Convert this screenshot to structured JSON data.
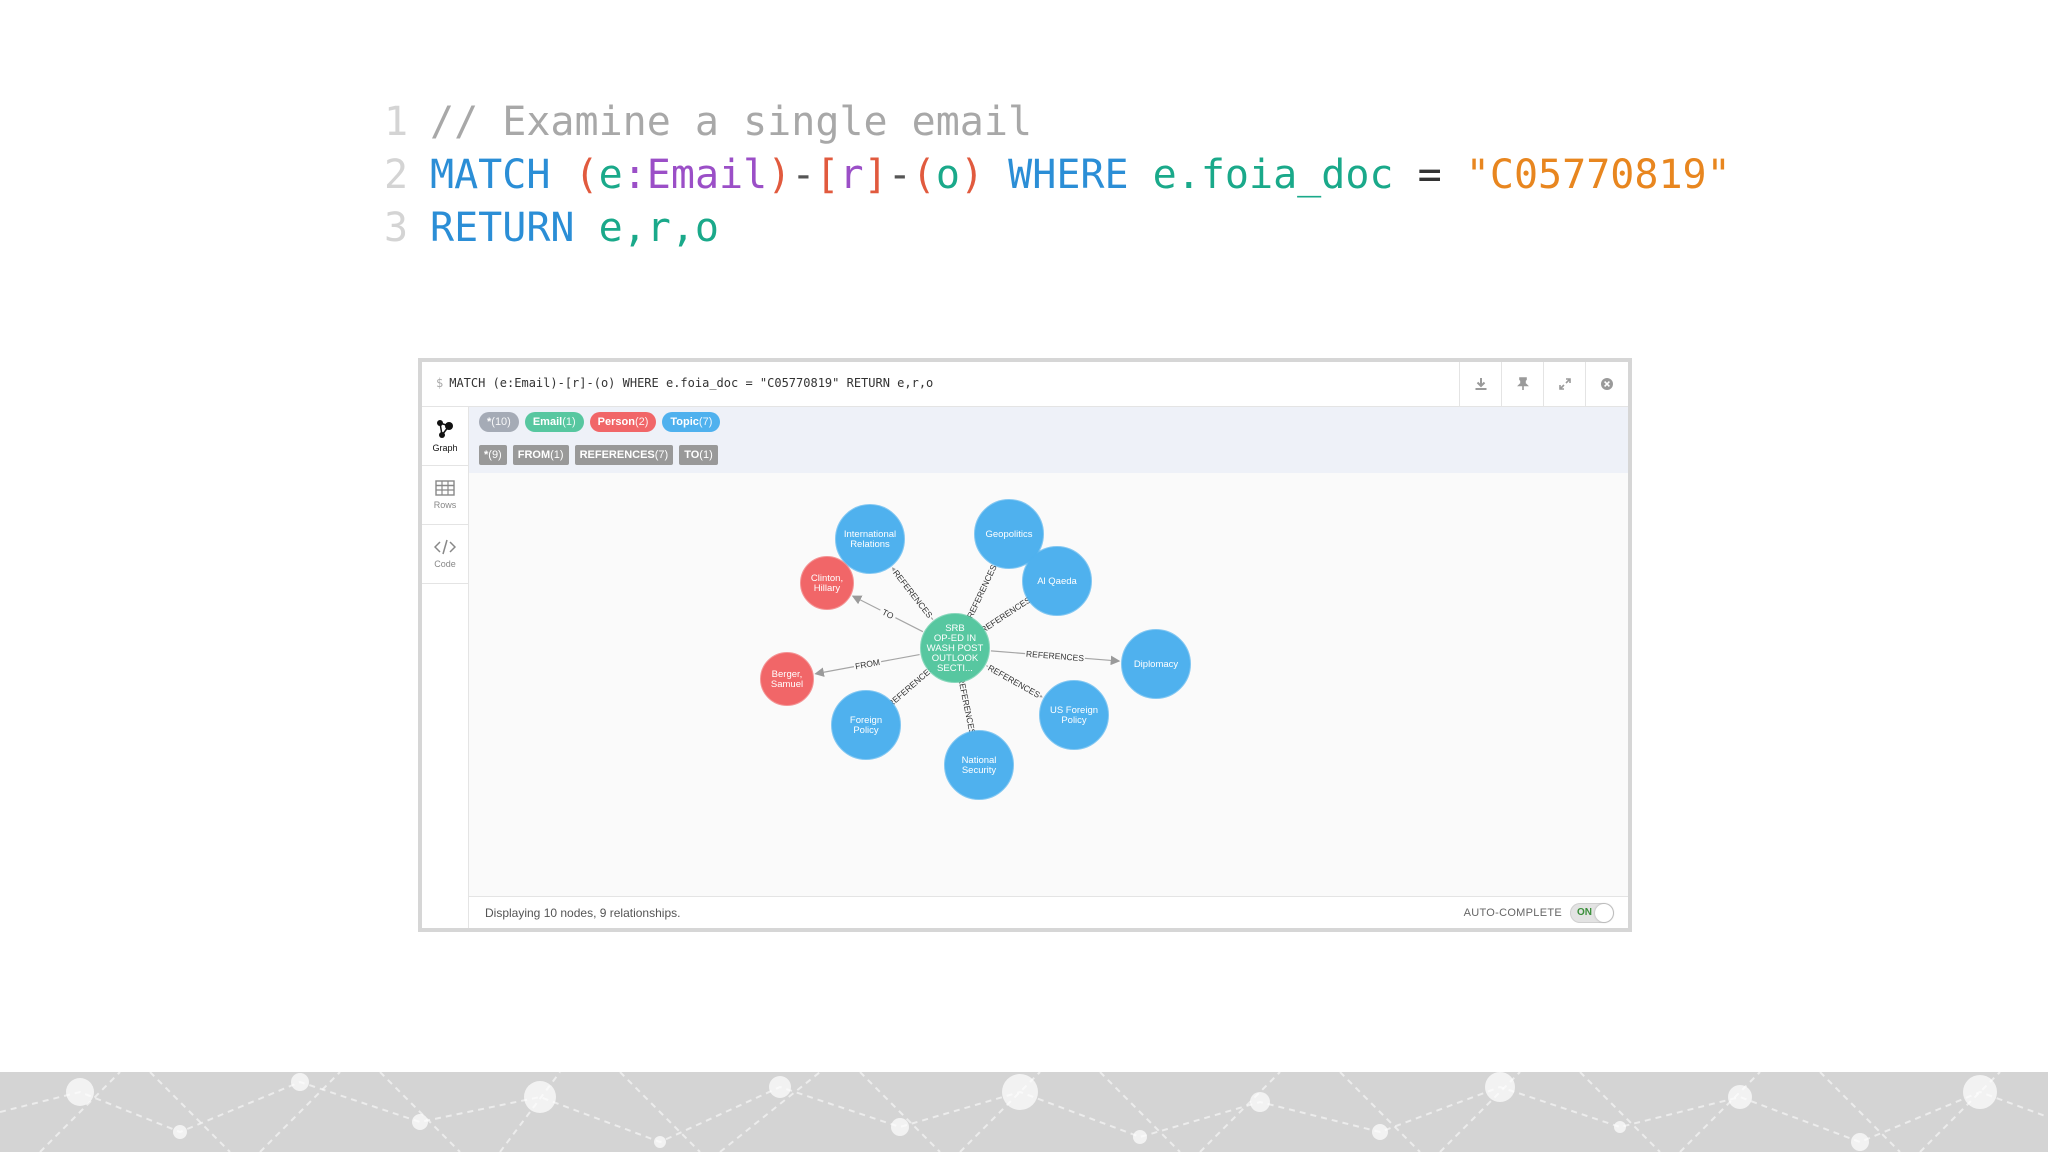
{
  "code": {
    "line_numbers": [
      "1",
      "2",
      "3"
    ],
    "comment": "// Examine a single email",
    "match_kw": "MATCH",
    "paren_open_e": "(",
    "var_e": "e",
    "colon": ":",
    "label_email": "Email",
    "paren_close_e": ")",
    "dash1": "-",
    "bracket_open": "[",
    "var_r": "r",
    "bracket_close": "]",
    "dash2": "-",
    "paren_open_o": "(",
    "var_o": "o",
    "paren_close_o": ")",
    "where_kw": "WHERE",
    "prop": "e.foia_doc",
    "eq": "=",
    "string": "\"C05770819\"",
    "return_kw": "RETURN",
    "return_vars": "e,r,o"
  },
  "frame": {
    "prompt": "$",
    "query": "MATCH (e:Email)-[r]-(o) WHERE e.foia_doc = \"C05770819\" RETURN e,r,o",
    "header_buttons": [
      "download-icon",
      "pin-icon",
      "expand-icon",
      "close-icon"
    ],
    "sidebar": [
      {
        "label": "Graph",
        "icon": "graph-icon"
      },
      {
        "label": "Rows",
        "icon": "table-icon"
      },
      {
        "label": "Code",
        "icon": "code-icon"
      }
    ],
    "node_labels": [
      {
        "name": "*",
        "count": "(10)",
        "color": "#a5abb6"
      },
      {
        "name": "Email",
        "count": "(1)",
        "color": "#57c7a0"
      },
      {
        "name": "Person",
        "count": "(2)",
        "color": "#f16668"
      },
      {
        "name": "Topic",
        "count": "(7)",
        "color": "#4fb1ee"
      }
    ],
    "rel_types": [
      {
        "name": "*",
        "count": "(9)"
      },
      {
        "name": "FROM",
        "count": "(1)"
      },
      {
        "name": "REFERENCES",
        "count": "(7)"
      },
      {
        "name": "TO",
        "count": "(1)"
      }
    ],
    "status": "Displaying 10 nodes, 9 relationships.",
    "autocomplete_label": "AUTO-COMPLETE",
    "autocomplete_state": "ON"
  },
  "graph": {
    "colors": {
      "email": "#57c7a0",
      "person": "#f16668",
      "topic": "#4fb1ee"
    },
    "center": {
      "lines": [
        "SRB",
        "OP-ED IN",
        "WASH POST",
        "OUTLOOK",
        "SECTI..."
      ],
      "type": "email"
    },
    "nodes": [
      {
        "id": "ir",
        "type": "topic",
        "lines": [
          "International",
          "Relations"
        ],
        "rel": "REFERENCES",
        "dir": "out"
      },
      {
        "id": "geo",
        "type": "topic",
        "lines": [
          "Geopolitics"
        ],
        "rel": "REFERENCES",
        "dir": "out"
      },
      {
        "id": "aq",
        "type": "topic",
        "lines": [
          "Al Qaeda"
        ],
        "rel": "REFERENCES",
        "dir": "out"
      },
      {
        "id": "dip",
        "type": "topic",
        "lines": [
          "Diplomacy"
        ],
        "rel": "REFERENCES",
        "dir": "out"
      },
      {
        "id": "usfp",
        "type": "topic",
        "lines": [
          "US Foreign",
          "Policy"
        ],
        "rel": "REFERENCES",
        "dir": "out"
      },
      {
        "id": "ns",
        "type": "topic",
        "lines": [
          "National",
          "Security"
        ],
        "rel": "REFERENCES",
        "dir": "out"
      },
      {
        "id": "fp",
        "type": "topic",
        "lines": [
          "Foreign",
          "Policy"
        ],
        "rel": "REFERENCES",
        "dir": "out"
      },
      {
        "id": "bs",
        "type": "person",
        "lines": [
          "Berger,",
          "Samuel"
        ],
        "rel": "FROM",
        "dir": "out"
      },
      {
        "id": "ch",
        "type": "person",
        "lines": [
          "Clinton,",
          "Hillary"
        ],
        "rel": "TO",
        "dir": "out"
      }
    ]
  }
}
